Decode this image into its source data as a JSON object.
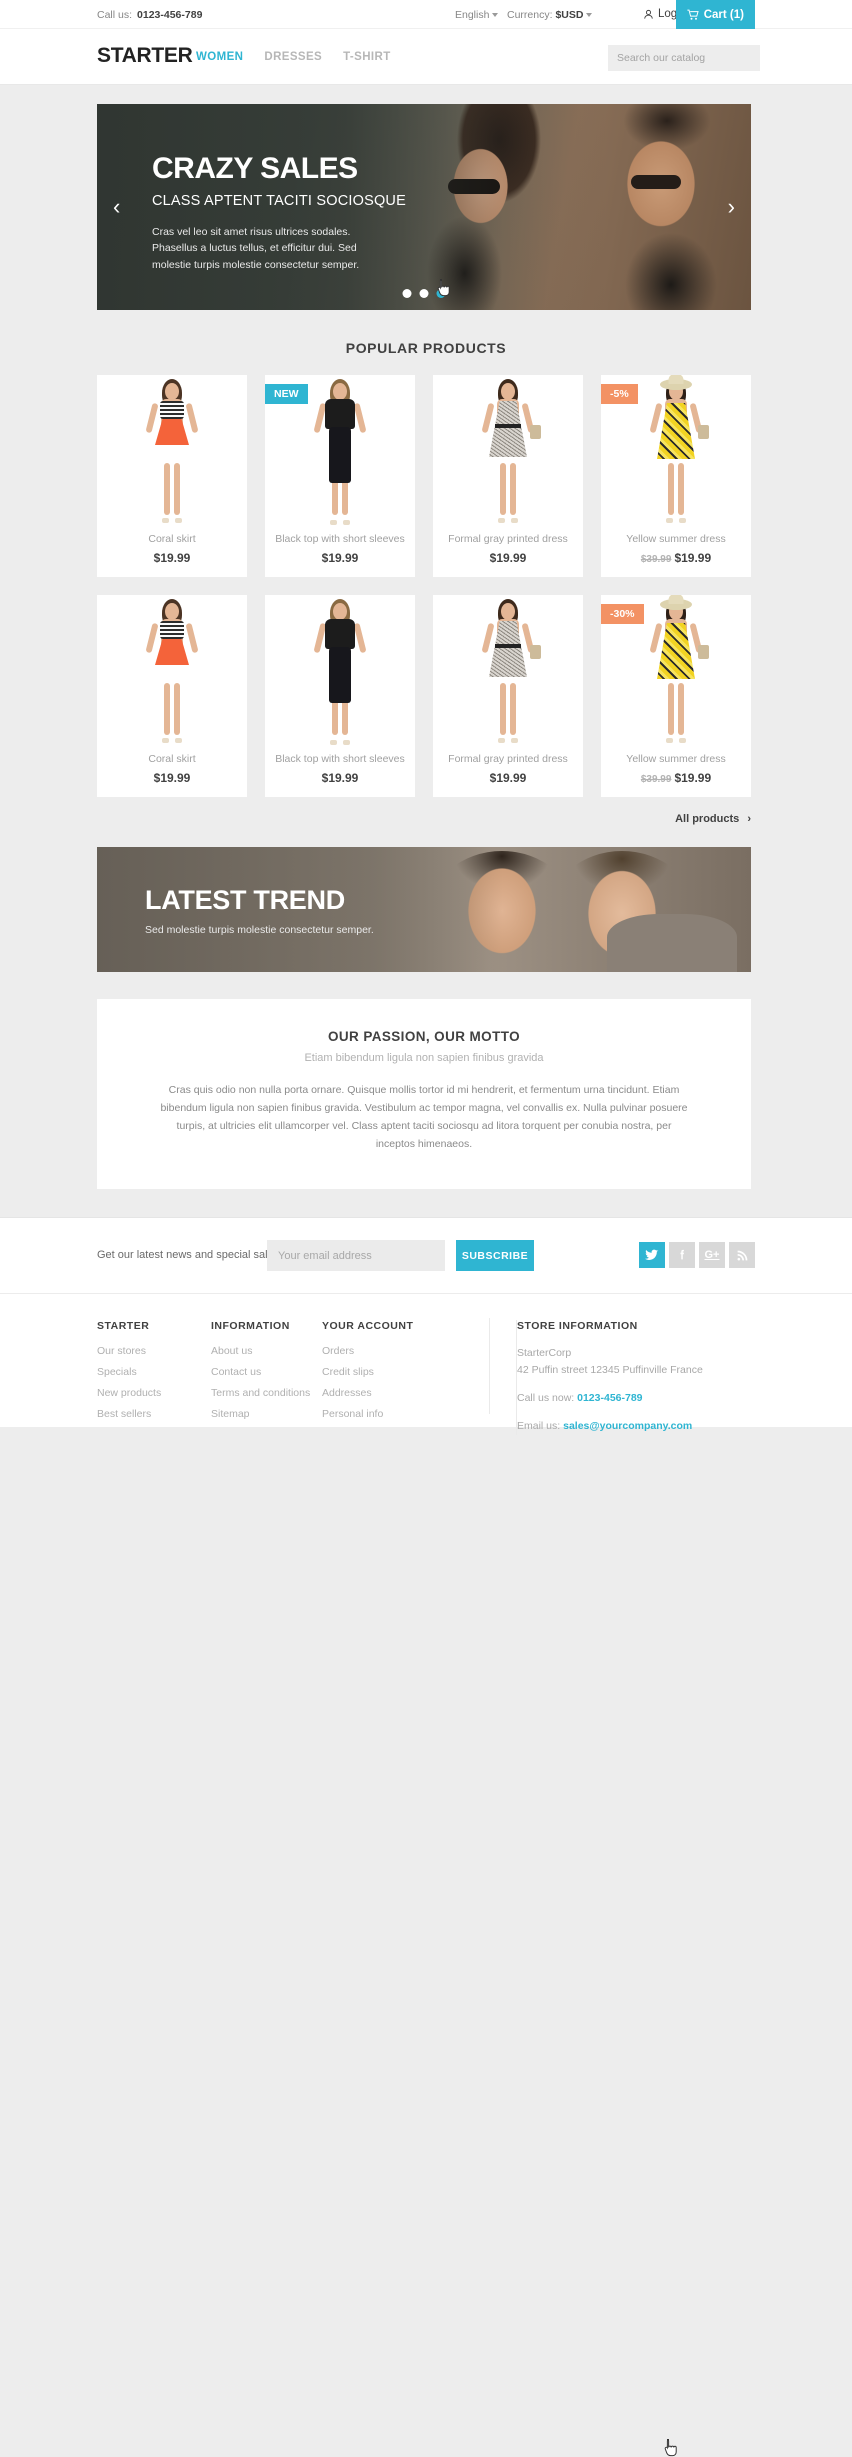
{
  "topbar": {
    "call_label": "Call us:",
    "phone": "0123-456-789",
    "language": "English",
    "currency_label": "Currency:",
    "currency": "$USD",
    "login": "Log in",
    "cart": "Cart (1)"
  },
  "header": {
    "logo": "STARTER",
    "nav": [
      {
        "label": "WOMEN",
        "active": true
      },
      {
        "label": "DRESSES",
        "active": false
      },
      {
        "label": "T-SHIRT",
        "active": false
      }
    ],
    "search_placeholder": "Search our catalog",
    "search_value": ""
  },
  "slider": {
    "title": "CRAZY SALES",
    "subtitle": "CLASS APTENT TACITI SOCIOSQUE",
    "body": "Cras vel leo sit amet risus ultrices sodales. Phasellus a luctus tellus, et efficitur dui. Sed molestie turpis molestie consectetur semper.",
    "prev": "‹",
    "next": "›",
    "dots": 3,
    "active_dot": 3
  },
  "products_section": {
    "title": "POPULAR PRODUCTS",
    "all_products": "All products",
    "all_products_chevron": "›",
    "rows": [
      [
        {
          "name": "Coral skirt",
          "price": "$19.99",
          "old_price": "",
          "badge": "",
          "badge_type": "",
          "model": "coral"
        },
        {
          "name": "Black top with short sleeves",
          "price": "$19.99",
          "old_price": "",
          "badge": "NEW",
          "badge_type": "new",
          "model": "black"
        },
        {
          "name": "Formal gray printed dress",
          "price": "$19.99",
          "old_price": "",
          "badge": "",
          "badge_type": "",
          "model": "gray"
        },
        {
          "name": "Yellow summer dress",
          "price": "$19.99",
          "old_price": "$39.99",
          "badge": "-5%",
          "badge_type": "disc",
          "model": "yellow"
        }
      ],
      [
        {
          "name": "Coral skirt",
          "price": "$19.99",
          "old_price": "",
          "badge": "",
          "badge_type": "",
          "model": "coral"
        },
        {
          "name": "Black top with short sleeves",
          "price": "$19.99",
          "old_price": "",
          "badge": "",
          "badge_type": "",
          "model": "black"
        },
        {
          "name": "Formal gray printed dress",
          "price": "$19.99",
          "old_price": "",
          "badge": "",
          "badge_type": "",
          "model": "gray"
        },
        {
          "name": "Yellow summer dress",
          "price": "$19.99",
          "old_price": "$39.99",
          "badge": "-30%",
          "badge_type": "disc",
          "model": "yellow"
        }
      ]
    ]
  },
  "trend": {
    "title": "LATEST TREND",
    "subtitle": "Sed molestie turpis molestie consectetur semper."
  },
  "motto": {
    "title": "OUR PASSION, OUR MOTTO",
    "subtitle": "Etiam bibendum ligula non sapien finibus gravida",
    "body": "Cras quis odio non nulla porta ornare. Quisque mollis tortor id mi hendrerit, et fermentum urna tincidunt. Etiam bibendum ligula non sapien finibus gravida. Vestibulum ac tempor magna, vel convallis ex. Nulla pulvinar posuere turpis, at ultricies elit ullamcorper vel. Class aptent taciti sociosqu ad litora torquent per conubia nostra, per inceptos himenaeos."
  },
  "newsletter": {
    "label": "Get our latest news and special sales",
    "placeholder": "Your email address",
    "value": "",
    "button": "SUBSCRIBE",
    "socials": [
      {
        "name": "twitter",
        "glyph": "✉",
        "active": true
      },
      {
        "name": "facebook",
        "glyph": "f",
        "active": false
      },
      {
        "name": "google-plus",
        "glyph": "G+",
        "active": false
      },
      {
        "name": "rss",
        "glyph": "◔",
        "active": false
      }
    ]
  },
  "footer": {
    "columns": [
      {
        "title": "STARTER",
        "links": [
          "Our stores",
          "Specials",
          "New products",
          "Best sellers"
        ]
      },
      {
        "title": "INFORMATION",
        "links": [
          "About us",
          "Contact us",
          "Terms and conditions",
          "Sitemap"
        ]
      },
      {
        "title": "YOUR ACCOUNT",
        "links": [
          "Orders",
          "Credit slips",
          "Addresses",
          "Personal info"
        ]
      }
    ],
    "store": {
      "title": "STORE INFORMATION",
      "company": "StarterCorp",
      "address": "42 Puffin street 12345 Puffinville France",
      "phone_label": "Call us now:",
      "phone": "0123-456-789",
      "email_label": "Email us:",
      "email": "sales@yourcompany.com"
    }
  },
  "colors": {
    "accent": "#2fb5d2",
    "discount": "#f39264",
    "page_bg": "#ededed",
    "text_dark": "#414141",
    "text_muted": "#a0a0a0"
  }
}
